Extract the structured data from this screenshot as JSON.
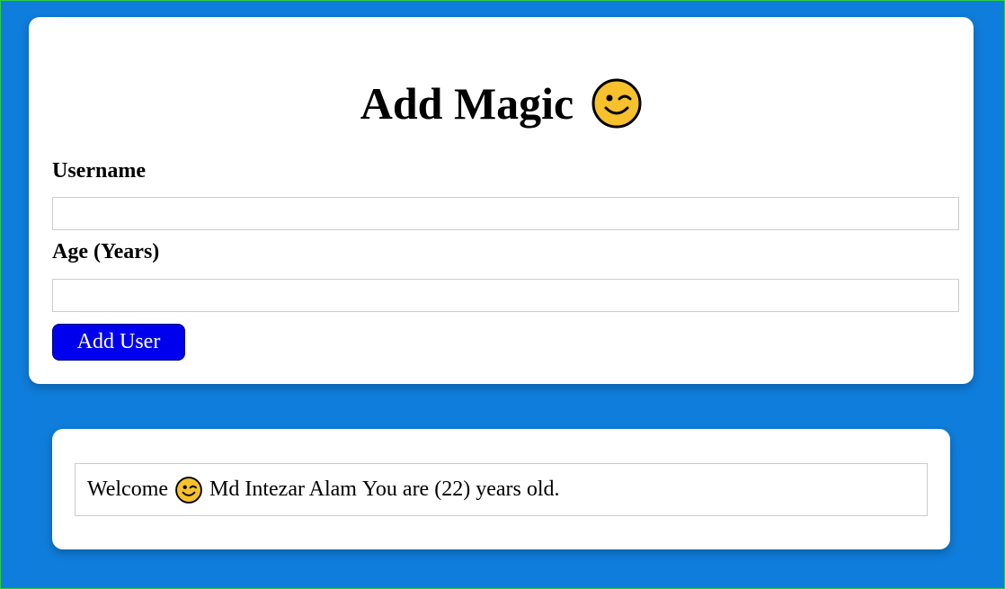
{
  "form": {
    "title": "Add Magic",
    "title_icon": "winking-face-icon",
    "username_label": "Username",
    "username_value": "",
    "age_label": "Age (Years)",
    "age_value": "",
    "submit_label": "Add User"
  },
  "users": [
    {
      "prefix": "Welcome",
      "icon": "winking-face-icon",
      "name": "Md Intezar Alam",
      "age_text": "You are (22) years old."
    }
  ],
  "colors": {
    "page_background": "#0f7ddb",
    "card_background": "#ffffff",
    "button_background": "#0000ee",
    "button_text": "#ffffff",
    "emoji_yellow": "#f6c12c"
  }
}
